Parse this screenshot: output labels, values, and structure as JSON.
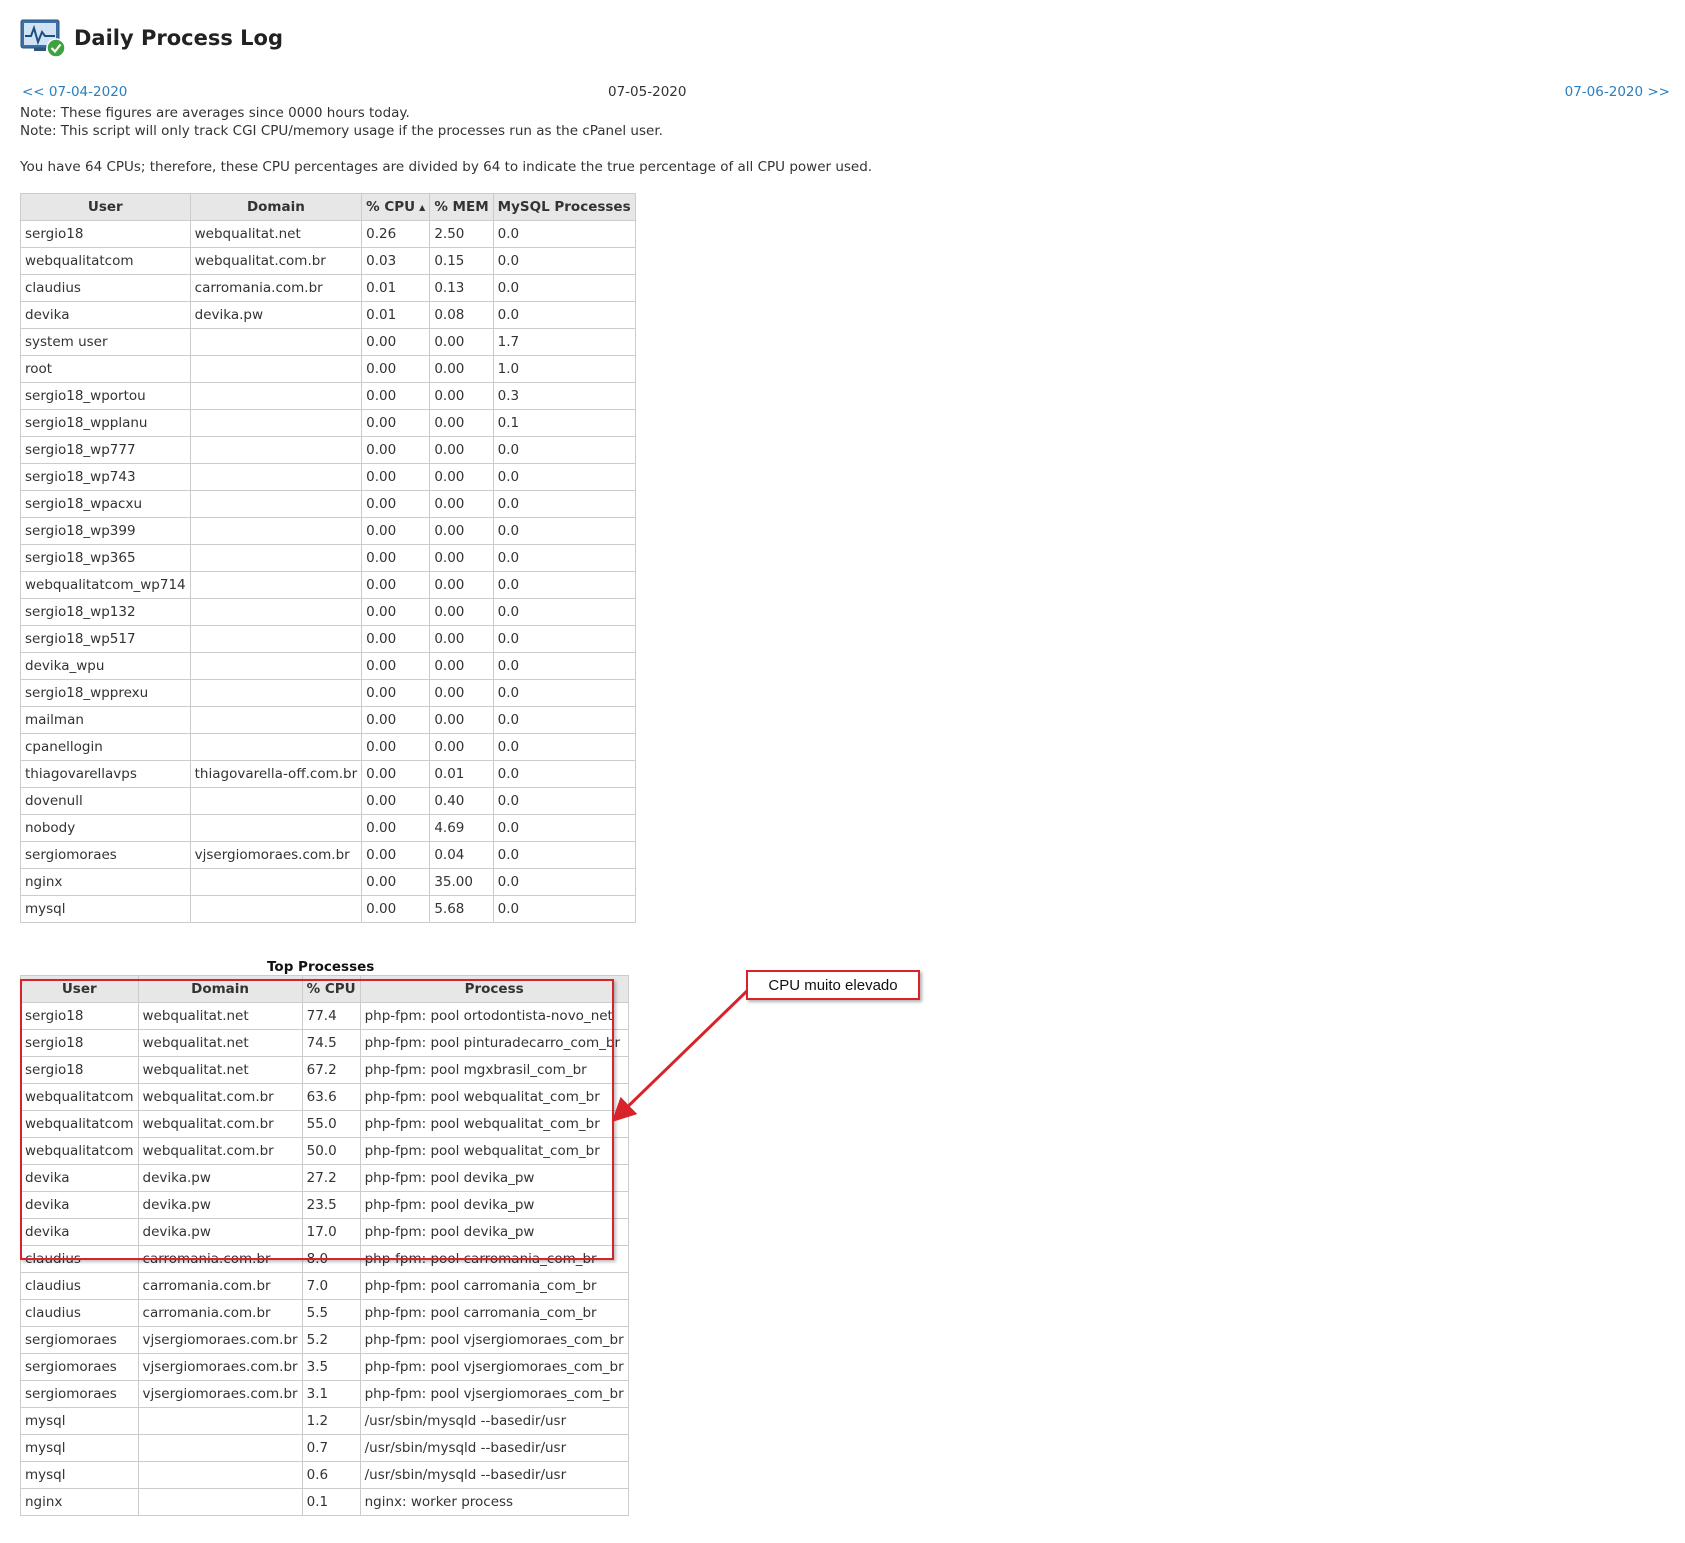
{
  "header": {
    "title": "Daily Process Log",
    "icon": "process-monitor-icon"
  },
  "nav": {
    "prev": "<< 07-04-2020",
    "current": "07-05-2020",
    "next": "07-06-2020 >>"
  },
  "notes": [
    "Note: These figures are averages since 0000 hours today.",
    "Note: This script will only track CGI CPU/memory usage if the processes run as the cPanel user."
  ],
  "cpu_note": "You have 64 CPUs; therefore, these CPU percentages are divided by 64 to indicate the true percentage of all CPU power used.",
  "usage_table": {
    "headers": [
      "User",
      "Domain",
      "% CPU",
      "% MEM",
      "MySQL Processes"
    ],
    "sort_indicator": "▲",
    "rows": [
      [
        "sergio18",
        "webqualitat.net",
        "0.26",
        "2.50",
        "0.0"
      ],
      [
        "webqualitatcom",
        "webqualitat.com.br",
        "0.03",
        "0.15",
        "0.0"
      ],
      [
        "claudius",
        "carromania.com.br",
        "0.01",
        "0.13",
        "0.0"
      ],
      [
        "devika",
        "devika.pw",
        "0.01",
        "0.08",
        "0.0"
      ],
      [
        "system user",
        "",
        "0.00",
        "0.00",
        "1.7"
      ],
      [
        "root",
        "",
        "0.00",
        "0.00",
        "1.0"
      ],
      [
        "sergio18_wportou",
        "",
        "0.00",
        "0.00",
        "0.3"
      ],
      [
        "sergio18_wpplanu",
        "",
        "0.00",
        "0.00",
        "0.1"
      ],
      [
        "sergio18_wp777",
        "",
        "0.00",
        "0.00",
        "0.0"
      ],
      [
        "sergio18_wp743",
        "",
        "0.00",
        "0.00",
        "0.0"
      ],
      [
        "sergio18_wpacxu",
        "",
        "0.00",
        "0.00",
        "0.0"
      ],
      [
        "sergio18_wp399",
        "",
        "0.00",
        "0.00",
        "0.0"
      ],
      [
        "sergio18_wp365",
        "",
        "0.00",
        "0.00",
        "0.0"
      ],
      [
        "webqualitatcom_wp714",
        "",
        "0.00",
        "0.00",
        "0.0"
      ],
      [
        "sergio18_wp132",
        "",
        "0.00",
        "0.00",
        "0.0"
      ],
      [
        "sergio18_wp517",
        "",
        "0.00",
        "0.00",
        "0.0"
      ],
      [
        "devika_wpu",
        "",
        "0.00",
        "0.00",
        "0.0"
      ],
      [
        "sergio18_wpprexu",
        "",
        "0.00",
        "0.00",
        "0.0"
      ],
      [
        "mailman",
        "",
        "0.00",
        "0.00",
        "0.0"
      ],
      [
        "cpanellogin",
        "",
        "0.00",
        "0.00",
        "0.0"
      ],
      [
        "thiagovarellavps",
        "thiagovarella-off.com.br",
        "0.00",
        "0.01",
        "0.0"
      ],
      [
        "dovenull",
        "",
        "0.00",
        "0.40",
        "0.0"
      ],
      [
        "nobody",
        "",
        "0.00",
        "4.69",
        "0.0"
      ],
      [
        "sergiomoraes",
        "vjsergiomoraes.com.br",
        "0.00",
        "0.04",
        "0.0"
      ],
      [
        "nginx",
        "",
        "0.00",
        "35.00",
        "0.0"
      ],
      [
        "mysql",
        "",
        "0.00",
        "5.68",
        "0.0"
      ]
    ]
  },
  "top_processes": {
    "caption": "Top Processes",
    "headers": [
      "User",
      "Domain",
      "% CPU",
      "Process"
    ],
    "rows": [
      [
        "sergio18",
        "webqualitat.net",
        "77.4",
        "php-fpm: pool ortodontista-novo_net"
      ],
      [
        "sergio18",
        "webqualitat.net",
        "74.5",
        "php-fpm: pool pinturadecarro_com_br"
      ],
      [
        "sergio18",
        "webqualitat.net",
        "67.2",
        "php-fpm: pool mgxbrasil_com_br"
      ],
      [
        "webqualitatcom",
        "webqualitat.com.br",
        "63.6",
        "php-fpm: pool webqualitat_com_br"
      ],
      [
        "webqualitatcom",
        "webqualitat.com.br",
        "55.0",
        "php-fpm: pool webqualitat_com_br"
      ],
      [
        "webqualitatcom",
        "webqualitat.com.br",
        "50.0",
        "php-fpm: pool webqualitat_com_br"
      ],
      [
        "devika",
        "devika.pw",
        "27.2",
        "php-fpm: pool devika_pw"
      ],
      [
        "devika",
        "devika.pw",
        "23.5",
        "php-fpm: pool devika_pw"
      ],
      [
        "devika",
        "devika.pw",
        "17.0",
        "php-fpm: pool devika_pw"
      ],
      [
        "claudius",
        "carromania.com.br",
        "8.0",
        "php-fpm: pool carromania_com_br"
      ],
      [
        "claudius",
        "carromania.com.br",
        "7.0",
        "php-fpm: pool carromania_com_br"
      ],
      [
        "claudius",
        "carromania.com.br",
        "5.5",
        "php-fpm: pool carromania_com_br"
      ],
      [
        "sergiomoraes",
        "vjsergiomoraes.com.br",
        "5.2",
        "php-fpm: pool vjsergiomoraes_com_br"
      ],
      [
        "sergiomoraes",
        "vjsergiomoraes.com.br",
        "3.5",
        "php-fpm: pool vjsergiomoraes_com_br"
      ],
      [
        "sergiomoraes",
        "vjsergiomoraes.com.br",
        "3.1",
        "php-fpm: pool vjsergiomoraes_com_br"
      ],
      [
        "mysql",
        "",
        "1.2",
        "/usr/sbin/mysqld --basedir/usr"
      ],
      [
        "mysql",
        "",
        "0.7",
        "/usr/sbin/mysqld --basedir/usr"
      ],
      [
        "mysql",
        "",
        "0.6",
        "/usr/sbin/mysqld --basedir/usr"
      ],
      [
        "nginx",
        "",
        "0.1",
        "nginx: worker process"
      ]
    ]
  },
  "annotation": {
    "callout_text": "CPU muito elevado",
    "accent_color": "#d9232b"
  }
}
